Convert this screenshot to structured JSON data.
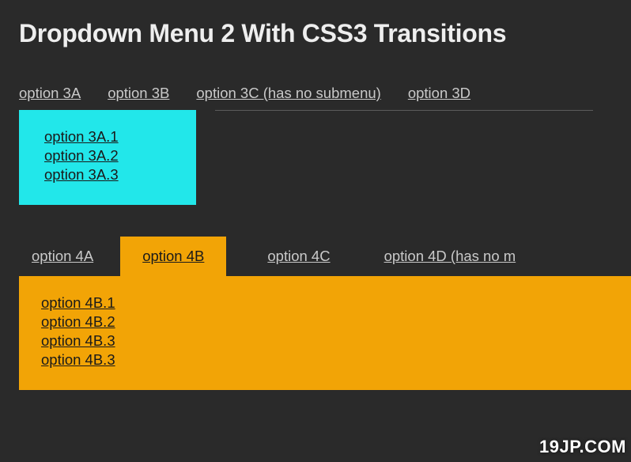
{
  "title": "Dropdown Menu 2 With CSS3 Transitions",
  "menu3": {
    "items": [
      {
        "label": "option 3A"
      },
      {
        "label": "option 3B"
      },
      {
        "label": "option 3C (has no submenu)"
      },
      {
        "label": "option 3D"
      }
    ],
    "submenu_3a": [
      "option 3A.1",
      "option 3A.2",
      "option 3A.3"
    ]
  },
  "menu4": {
    "items": [
      {
        "label": "option 4A",
        "active": false
      },
      {
        "label": "option 4B",
        "active": true
      },
      {
        "label": "option 4C",
        "active": false
      },
      {
        "label": "option 4D (has no m",
        "active": false
      }
    ],
    "submenu_4b": [
      "option 4B.1",
      "option 4B.2",
      "option 4B.3",
      "option 4B.3"
    ]
  },
  "watermark": "19JP.COM"
}
